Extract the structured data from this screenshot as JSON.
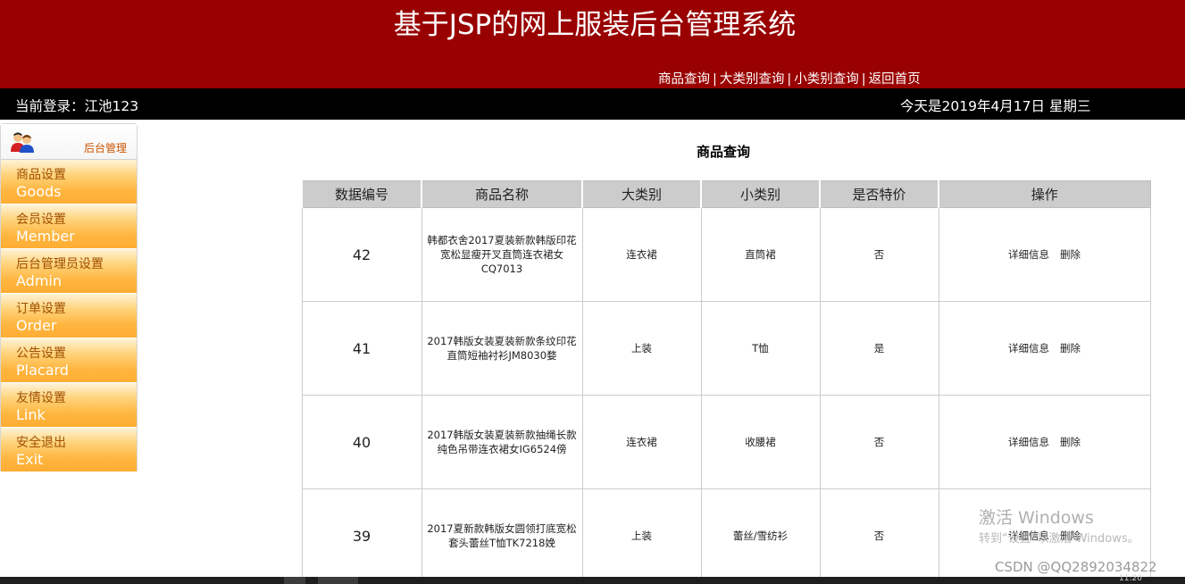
{
  "header": {
    "title": "基于JSP的网上服装后台管理系统",
    "nav": [
      "商品查询",
      "大类别查询",
      "小类别查询",
      "返回首页"
    ],
    "separator": "|"
  },
  "userbar": {
    "login": "当前登录：江池123",
    "date": "今天是2019年4月17日 星期三"
  },
  "sidebar": {
    "heading": "后台管理",
    "items": [
      {
        "zh": "商品设置",
        "en": "Goods"
      },
      {
        "zh": "会员设置",
        "en": "Member"
      },
      {
        "zh": "后台管理员设置",
        "en": "Admin"
      },
      {
        "zh": "订单设置",
        "en": "Order"
      },
      {
        "zh": "公告设置",
        "en": "Placard"
      },
      {
        "zh": "友情设置",
        "en": "Link"
      },
      {
        "zh": "安全退出",
        "en": "Exit"
      }
    ]
  },
  "main": {
    "title": "商品查询",
    "columns": [
      "数据编号",
      "商品名称",
      "大类别",
      "小类别",
      "是否特价",
      "操作"
    ],
    "rows": [
      {
        "id": "42",
        "name": "韩都衣舍2017夏装新款韩版印花宽松显瘦开叉直筒连衣裙女CQ7013",
        "big": "连衣裙",
        "small": "直筒裙",
        "special": "否",
        "detail": "详细信息",
        "delete": "删除"
      },
      {
        "id": "41",
        "name": "2017韩版女装夏装新款条纹印花直筒短袖衬衫JM8030婺",
        "big": "上装",
        "small": "T恤",
        "special": "是",
        "detail": "详细信息",
        "delete": "删除"
      },
      {
        "id": "40",
        "name": "2017韩版女装夏装新款抽绳长款纯色吊带连衣裙女IG6524傍",
        "big": "连衣裙",
        "small": "收腰裙",
        "special": "否",
        "detail": "详细信息",
        "delete": "删除"
      },
      {
        "id": "39",
        "name": "2017夏新款韩版女圆领打底宽松套头蕾丝T恤TK7218娩",
        "big": "上装",
        "small": "蕾丝/雪纺衫",
        "special": "否",
        "detail": "详细信息",
        "delete": "删除"
      }
    ]
  },
  "overlay": {
    "activate_line1": "激活 Windows",
    "activate_line2": "转到“设置”以激活 Windows。",
    "csdn": "CSDN @QQ2892034822",
    "clock": "11:20"
  },
  "colors": {
    "header_bg": "#990000",
    "userbar_bg": "#000000",
    "menu_orange": "#ffad33",
    "table_header_bg": "#cccccc"
  }
}
